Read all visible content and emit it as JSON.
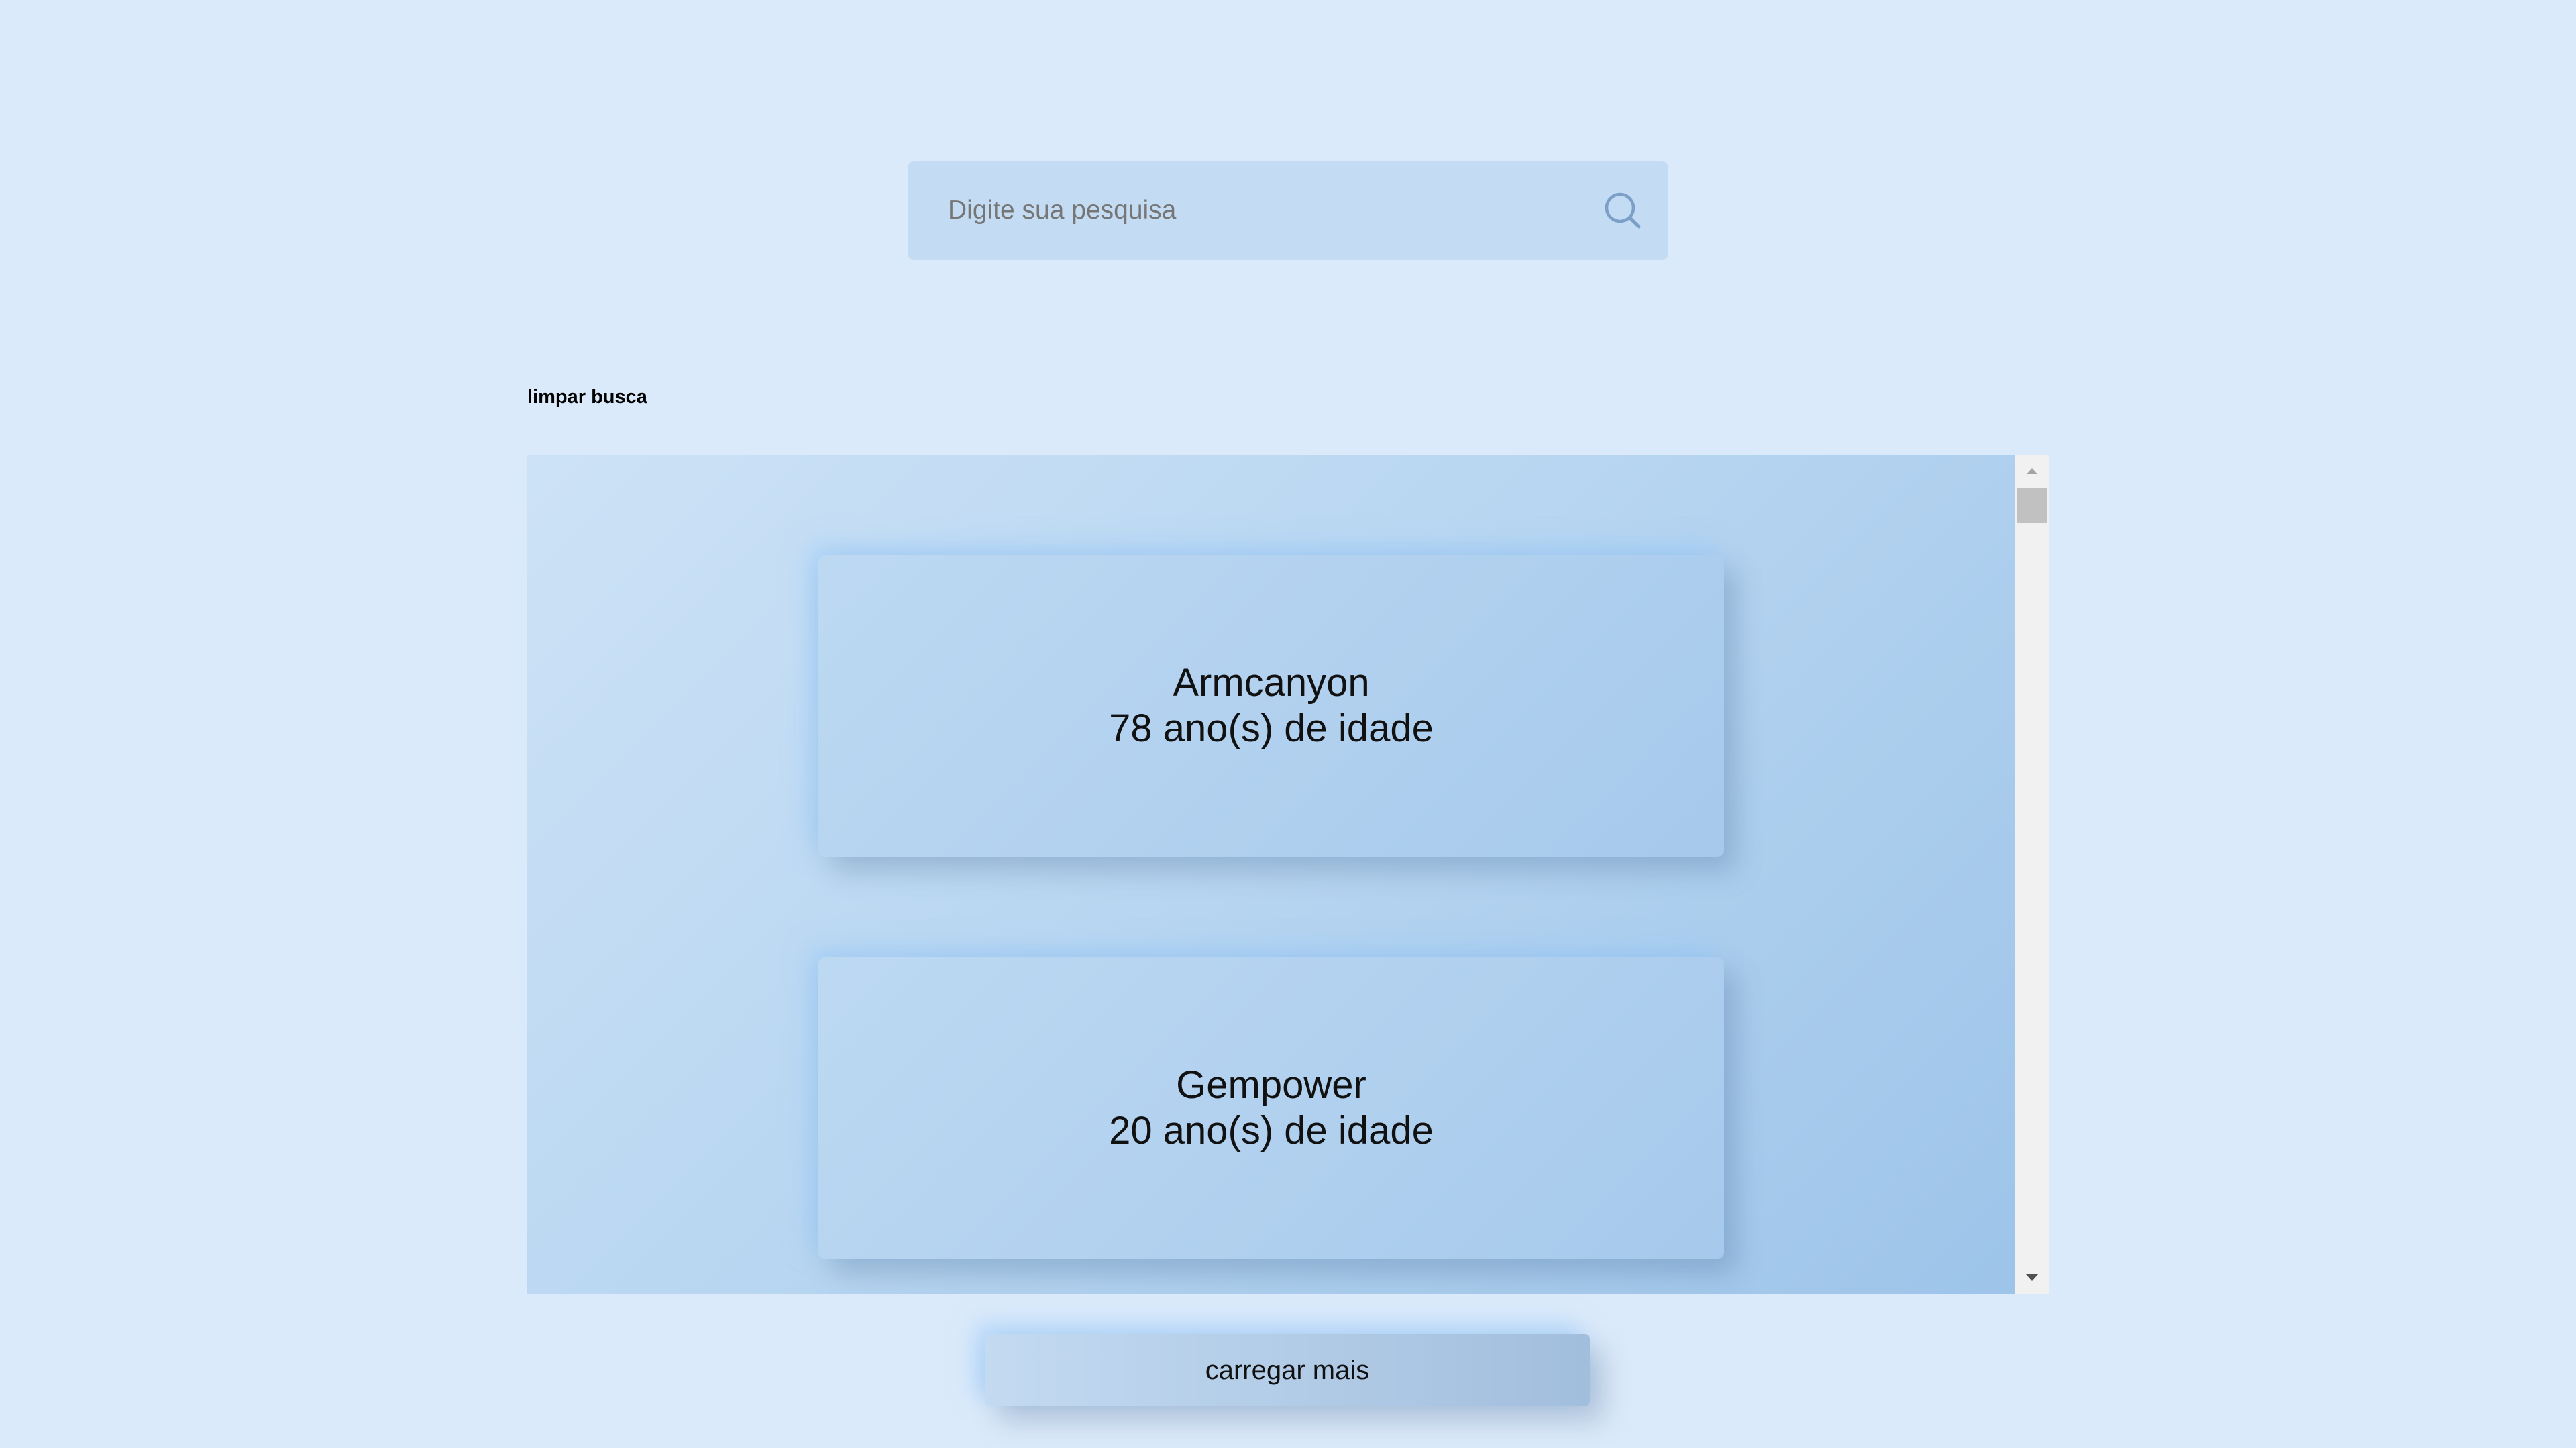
{
  "search": {
    "placeholder": "Digite sua pesquisa",
    "value": "",
    "icon": "search-icon"
  },
  "clear_search_label": "limpar busca",
  "results": [
    {
      "name": "Armcanyon",
      "age_text": "78 ano(s) de idade"
    },
    {
      "name": "Gempower",
      "age_text": "20 ano(s) de idade"
    }
  ],
  "load_more_label": "carregar mais",
  "colors": {
    "page_background": "#dbeafa",
    "search_background": "#c4dcf3",
    "search_icon": "#7b9fc6",
    "card_background": "#b3d2ef"
  }
}
